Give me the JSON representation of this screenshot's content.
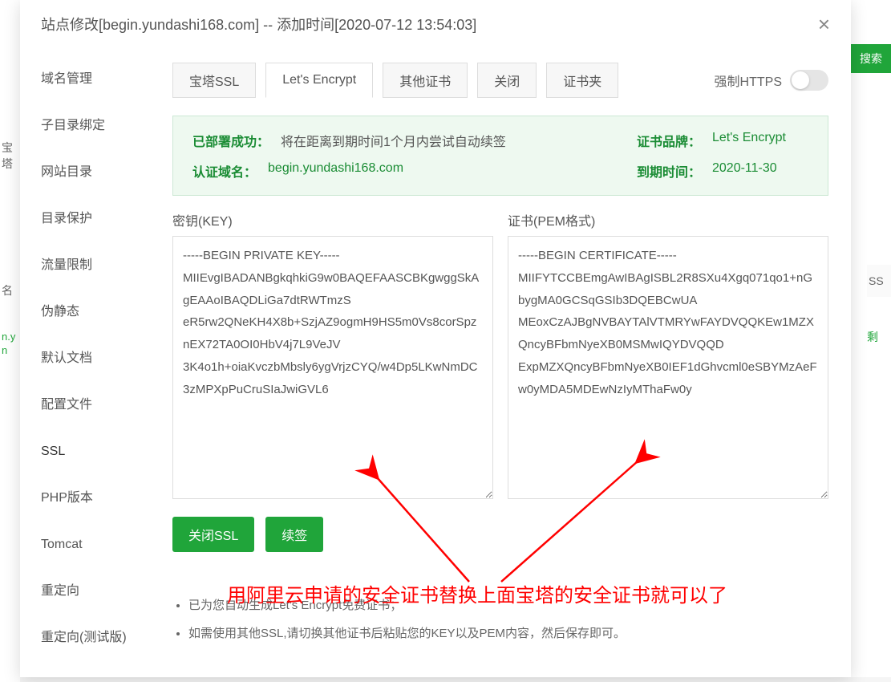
{
  "background": {
    "search_btn": "搜索",
    "col_ss_head": "SS",
    "col_ss_val": "剩",
    "left_label1": "宝塔",
    "left_label2": "名",
    "left_domain": "n.y\nn"
  },
  "modal": {
    "title": "站点修改[begin.yundashi168.com] -- 添加时间[2020-07-12 13:54:03]",
    "close": "×"
  },
  "sidebar": {
    "items": [
      "域名管理",
      "子目录绑定",
      "网站目录",
      "目录保护",
      "流量限制",
      "伪静态",
      "默认文档",
      "配置文件",
      "SSL",
      "PHP版本",
      "Tomcat",
      "重定向",
      "重定向(测试版)"
    ],
    "active_index": 8
  },
  "tabs": {
    "items": [
      "宝塔SSL",
      "Let's Encrypt",
      "其他证书",
      "关闭",
      "证书夹"
    ],
    "active_index": 1,
    "force_https_label": "强制HTTPS"
  },
  "status": {
    "deploy_label": "已部署成功：",
    "deploy_text": "将在距离到期时间1个月内尝试自动续签",
    "domain_label": "认证域名：",
    "domain_value": "begin.yundashi168.com",
    "brand_label": "证书品牌：",
    "brand_value": "Let's Encrypt",
    "expire_label": "到期时间：",
    "expire_value": "2020-11-30"
  },
  "cert": {
    "key_label": "密钥(KEY)",
    "pem_label": "证书(PEM格式)",
    "key_text": "-----BEGIN PRIVATE KEY-----\nMIIEvgIBADANBgkqhkiG9w0BAQEFAASCBKgwggSkAgEAAoIBAQDLiGa7dtRWTmzS\neR5rw2QNeKH4X8b+SzjAZ9ogmH9HS5m0Vs8corSpznEX72TA0OI0HbV4j7L9VeJV\n3K4o1h+oiaKvczbMbsly6ygVrjzCYQ/w4Dp5LKwNmDC3zMPXpPuCruSIaJwiGVL6",
    "pem_text": "-----BEGIN CERTIFICATE-----\nMIIFYTCCBEmgAwIBAgISBL2R8SXu4Xgq071qo1+nGbygMA0GCSqGSIb3DQEBCwUA\nMEoxCzAJBgNVBAYTAlVTMRYwFAYDVQQKEw1MZXQncyBFbmNyeXB0MSMwIQYDVQQD\nExpMZXQncyBFbmNyeXB0IEF1dGhvcml0eSBYMzAeFw0yMDA5MDEwNzIyMThaFw0y"
  },
  "buttons": {
    "close_ssl": "关闭SSL",
    "renew": "续签"
  },
  "annotation": "用阿里云申请的安全证书替换上面宝塔的安全证书就可以了",
  "notes": {
    "items": [
      "已为您自动生成Let's Encrypt免费证书；",
      "如需使用其他SSL,请切换其他证书后粘贴您的KEY以及PEM内容，然后保存即可。"
    ]
  }
}
